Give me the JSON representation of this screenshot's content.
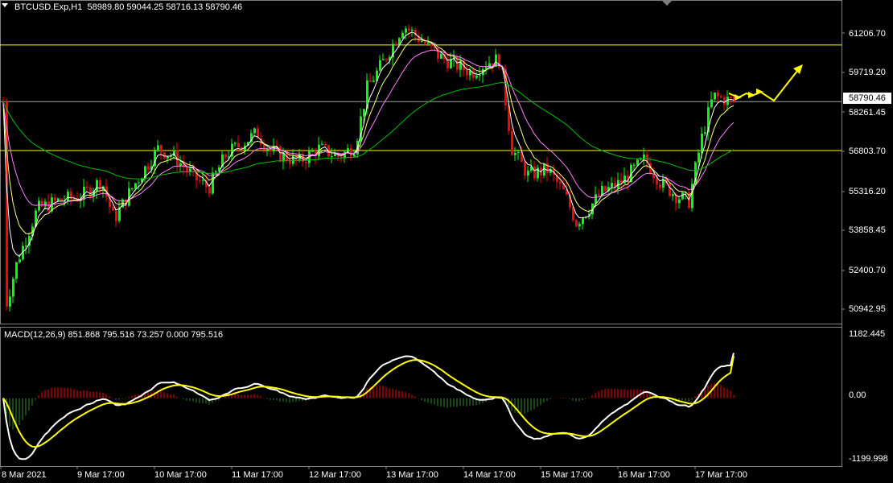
{
  "header": {
    "symbol": "BTCUSD.Exp,H1",
    "ohlc": "58989.80 59044.25 58716.13 58790.46"
  },
  "macd_header": {
    "label": "MACD(12,26,9)",
    "values": "851.868 795.516 73.257 0.000 795.516"
  },
  "price_axis": [
    "61206.70",
    "59719.20",
    "58261.45",
    "56803.70",
    "55316.20",
    "53858.45",
    "52400.70",
    "50942.95"
  ],
  "current_price": "58790.46",
  "macd_axis": [
    "1182.445",
    "0.00",
    "-1199.998"
  ],
  "time_axis": [
    "8 Mar 2021",
    "9 Mar 17:00",
    "10 Mar 17:00",
    "11 Mar 17:00",
    "12 Mar 17:00",
    "13 Mar 17:00",
    "14 Mar 17:00",
    "15 Mar 17:00",
    "16 Mar 17:00",
    "17 Mar 17:00"
  ],
  "colors": {
    "background": "#000000",
    "bull_candle": "#00FF00",
    "bear_candle": "#FF0000",
    "horizontal_lines": "#FFFF00",
    "ma_fast": "#FFFFFF",
    "ma_mid": "#FFFF80",
    "ma_slow": "#FF80FF",
    "ma_long": "#00C000",
    "macd_line": "#FFFFFF",
    "signal_line": "#FFFF00",
    "histogram": "#FF0000",
    "projection_arrow": "#FFFF00"
  },
  "chart_data": {
    "type": "candlestick",
    "instrument": "BTCUSD.Exp",
    "timeframe": "H1",
    "last": {
      "open": 58989.8,
      "high": 59044.25,
      "low": 58716.13,
      "close": 58790.46
    },
    "horizontal_levels": [
      60950,
      58790.46,
      56930
    ],
    "price_range": [
      50400,
      62600
    ],
    "macd_params": [
      12,
      26,
      9
    ],
    "macd_last": {
      "macd": 851.868,
      "signal": 795.516,
      "histogram": 73.257
    },
    "macd_range": [
      -1250,
      1300
    ],
    "approx_closes_by_session": [
      {
        "t": "8 Mar 2021",
        "close": 50900
      },
      {
        "t": "9 Mar 17:00",
        "close": 54300
      },
      {
        "t": "10 Mar 17:00",
        "close": 56300
      },
      {
        "t": "11 Mar 17:00",
        "close": 57000
      },
      {
        "t": "12 Mar 17:00",
        "close": 56950
      },
      {
        "t": "13 Mar 17:00",
        "close": 61000
      },
      {
        "t": "14 Mar 17:00",
        "close": 59500
      },
      {
        "t": "15 Mar 17:00",
        "close": 54200
      },
      {
        "t": "16 Mar 17:00",
        "close": 55400
      },
      {
        "t": "17 Mar 17:00",
        "close": 58790
      }
    ]
  }
}
